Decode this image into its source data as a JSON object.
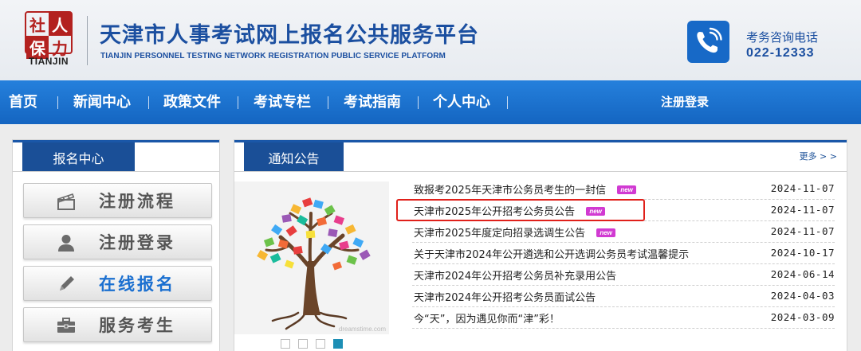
{
  "header": {
    "logo_chars": [
      "社",
      "人",
      "保",
      "力"
    ],
    "logo_word": "TIANJIN",
    "title": "天津市人事考试网上报名公共服务平台",
    "subtitle": "TIANJIN PERSONNEL TESTING NETWORK REGISTRATION PUBLIC SERVICE PLATFORM",
    "hotline_label": "考务咨询电话",
    "hotline_number": "022-12333",
    "phone_icon": "phone-icon"
  },
  "nav": {
    "items": [
      "首页",
      "新闻中心",
      "政策文件",
      "考试专栏",
      "考试指南",
      "个人中心"
    ],
    "register_login": "注册登录"
  },
  "sidebar": {
    "tab_title": "报名中心",
    "buttons": [
      {
        "label": "注册流程",
        "icon": "clapperboard-icon"
      },
      {
        "label": "注册登录",
        "icon": "user-icon"
      },
      {
        "label": "在线报名",
        "icon": "pen-icon"
      },
      {
        "label": "服务考生",
        "icon": "briefcase-icon"
      }
    ],
    "active_index": 2
  },
  "notices": {
    "tab_title": "通知公告",
    "more_label": "更多 > >",
    "watermark": "dreamstime.com",
    "slide_count": 4,
    "active_slide": 3,
    "items": [
      {
        "title": "致报考2025年天津市公务员考生的一封信",
        "date": "2024-11-07",
        "new": true
      },
      {
        "title": "天津市2025年公开招考公务员公告",
        "date": "2024-11-07",
        "new": true,
        "highlighted": true
      },
      {
        "title": "天津市2025年度定向招录选调生公告",
        "date": "2024-11-07",
        "new": true
      },
      {
        "title": "关于天津市2024年公开遴选和公开选调公务员考试温馨提示",
        "date": "2024-10-17",
        "new": false
      },
      {
        "title": "天津市2024年公开招考公务员补充录用公告",
        "date": "2024-06-14",
        "new": false
      },
      {
        "title": "天津市2024年公开招考公务员面试公告",
        "date": "2024-04-03",
        "new": false
      },
      {
        "title": "今“天”，因为遇见你而“津”彩！",
        "date": "2024-03-09",
        "new": false
      }
    ],
    "new_badge": "new"
  },
  "colors": {
    "brand_blue": "#1a4f97",
    "nav_blue": "#1a72d0",
    "highlight_red": "#e0201a",
    "badge_magenta": "#d13ad2"
  }
}
